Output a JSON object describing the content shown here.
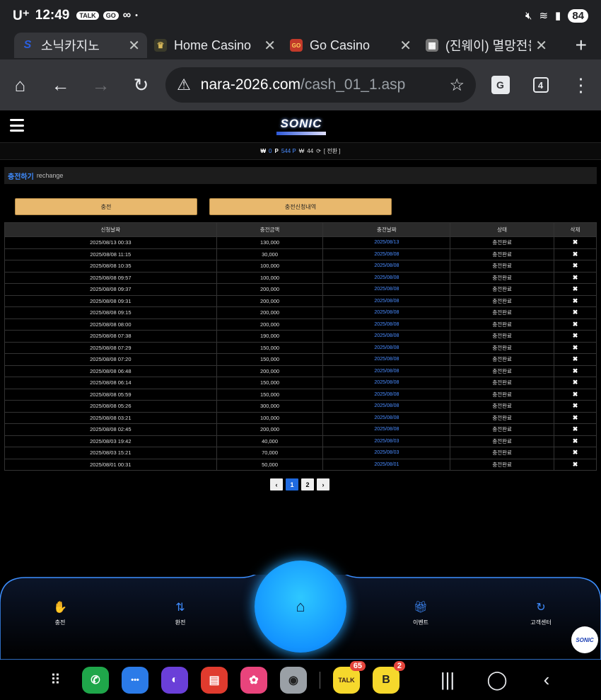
{
  "status_bar": {
    "carrier": "U⁺",
    "time": "12:49",
    "icons": [
      "TALK",
      "GO",
      "∞",
      "•"
    ],
    "battery": "84"
  },
  "tabs": [
    {
      "favicon": "S",
      "label": "소닉카지노",
      "active": true,
      "favicon_color": "#2b5fe0"
    },
    {
      "favicon": "♛",
      "label": "Home Casino",
      "active": false,
      "favicon_color": "#3a3a2a"
    },
    {
      "favicon": "GO",
      "label": "Go Casino",
      "active": false,
      "favicon_color": "#c23a2a"
    },
    {
      "favicon": "▦",
      "label": "(진웨이) 멸망전을",
      "active": false,
      "favicon_color": "#777"
    }
  ],
  "toolbar": {
    "url_host": "nara-2026.com",
    "url_path": "/cash_01_1.asp",
    "tab_count": "4",
    "translate_label": "G"
  },
  "header": {
    "logo_text": "SONIC"
  },
  "balance": {
    "won_symbol": "₩",
    "won_value": "0",
    "point_symbol": "P",
    "point_value": "544 P",
    "coin_value": "44",
    "convert_label": "[ 전환 ]"
  },
  "section": {
    "title_ko": "충전하기",
    "title_en": "rechange"
  },
  "buttons": {
    "charge": "충전",
    "history": "충전신청내역"
  },
  "table": {
    "headers": [
      "신청날짜",
      "충전금액",
      "충전날짜",
      "상태",
      "삭제"
    ],
    "rows": [
      [
        "2025/08/13 00:33",
        "130,000",
        "2025/08/13",
        "충전완료",
        "✖"
      ],
      [
        "2025/08/08 11:15",
        "30,000",
        "2025/08/08",
        "충전완료",
        "✖"
      ],
      [
        "2025/08/08 10:35",
        "100,000",
        "2025/08/08",
        "충전완료",
        "✖"
      ],
      [
        "2025/08/08 09:57",
        "100,000",
        "2025/08/08",
        "충전완료",
        "✖"
      ],
      [
        "2025/08/08 09:37",
        "200,000",
        "2025/08/08",
        "충전완료",
        "✖"
      ],
      [
        "2025/08/08 09:31",
        "200,000",
        "2025/08/08",
        "충전완료",
        "✖"
      ],
      [
        "2025/08/08 09:15",
        "200,000",
        "2025/08/08",
        "충전완료",
        "✖"
      ],
      [
        "2025/08/08 08:00",
        "200,000",
        "2025/08/08",
        "충전완료",
        "✖"
      ],
      [
        "2025/08/08 07:38",
        "190,000",
        "2025/08/08",
        "충전완료",
        "✖"
      ],
      [
        "2025/08/08 07:29",
        "150,000",
        "2025/08/08",
        "충전완료",
        "✖"
      ],
      [
        "2025/08/08 07:20",
        "150,000",
        "2025/08/08",
        "충전완료",
        "✖"
      ],
      [
        "2025/08/08 06:48",
        "200,000",
        "2025/08/08",
        "충전완료",
        "✖"
      ],
      [
        "2025/08/08 06:14",
        "150,000",
        "2025/08/08",
        "충전완료",
        "✖"
      ],
      [
        "2025/08/08 05:59",
        "150,000",
        "2025/08/08",
        "충전완료",
        "✖"
      ],
      [
        "2025/08/08 05:26",
        "300,000",
        "2025/08/08",
        "충전완료",
        "✖"
      ],
      [
        "2025/08/08 03:21",
        "100,000",
        "2025/08/08",
        "충전완료",
        "✖"
      ],
      [
        "2025/08/08 02:45",
        "200,000",
        "2025/08/08",
        "충전완료",
        "✖"
      ],
      [
        "2025/08/03 19:42",
        "40,000",
        "2025/08/03",
        "충전완료",
        "✖"
      ],
      [
        "2025/08/03 15:21",
        "70,000",
        "2025/08/03",
        "충전완료",
        "✖"
      ],
      [
        "2025/08/01 00:31",
        "50,000",
        "2025/08/01",
        "충전완료",
        "✖"
      ]
    ]
  },
  "pagination": {
    "prev": "‹",
    "pages": [
      "1",
      "2"
    ],
    "current": "1",
    "next": "›"
  },
  "bottom_nav": {
    "items": [
      {
        "label": "충전",
        "icon": "hand-coin-icon"
      },
      {
        "label": "환전",
        "icon": "exchange-icon"
      },
      {
        "label": "이벤트",
        "icon": "gift-icon"
      },
      {
        "label": "고객센터",
        "icon": "support-icon"
      }
    ],
    "home_icon": "home-icon",
    "badge_text": "SONIC"
  },
  "android": {
    "apps": [
      {
        "name": "phone",
        "glyph": "✆",
        "color": "#1fa64a"
      },
      {
        "name": "messages",
        "glyph": "•••",
        "color": "#2b7be8"
      },
      {
        "name": "internet",
        "glyph": "◐",
        "color": "#6a3fd8"
      },
      {
        "name": "notes",
        "glyph": "▤",
        "color": "#e03b2e"
      },
      {
        "name": "gallery",
        "glyph": "✿",
        "color": "#e9447c"
      },
      {
        "name": "camera",
        "glyph": "◉",
        "color": "#9aa0a6"
      },
      {
        "name": "kakaotalk",
        "glyph": "TALK",
        "color": "#f6d82c",
        "badge": "65"
      },
      {
        "name": "kakaopage",
        "glyph": "B",
        "color": "#f6d82c",
        "badge": "2"
      }
    ],
    "nav": [
      "|||",
      "◯",
      "‹"
    ]
  }
}
